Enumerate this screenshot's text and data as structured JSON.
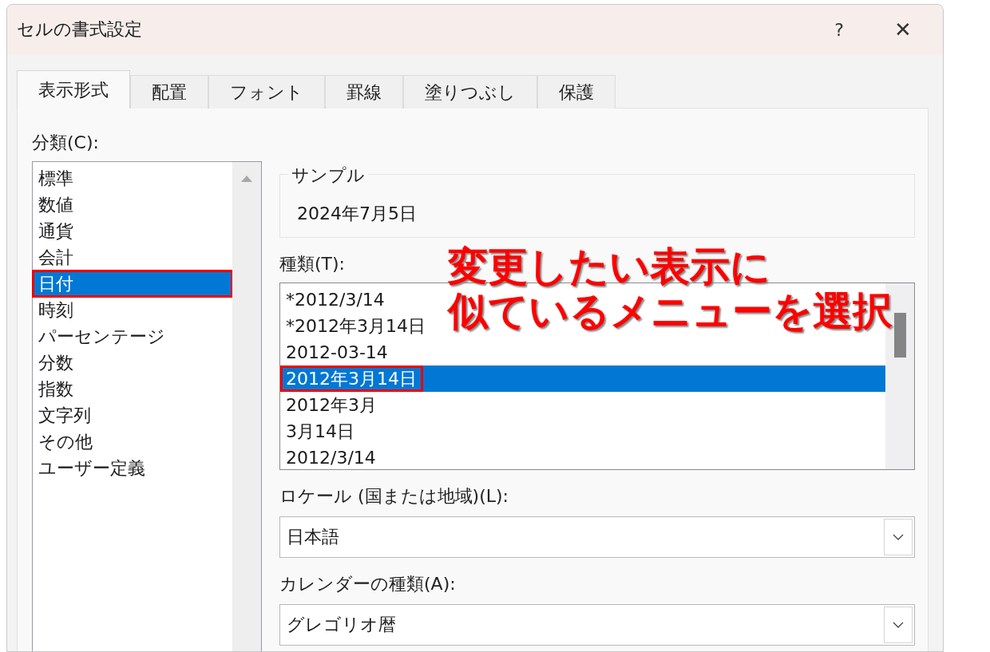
{
  "window": {
    "title": "セルの書式設定",
    "help": "?",
    "close": "✕"
  },
  "tabs": [
    {
      "label": "表示形式",
      "selected": true
    },
    {
      "label": "配置",
      "selected": false
    },
    {
      "label": "フォント",
      "selected": false
    },
    {
      "label": "罫線",
      "selected": false
    },
    {
      "label": "塗りつぶし",
      "selected": false
    },
    {
      "label": "保護",
      "selected": false
    }
  ],
  "category": {
    "label": "分類(C):",
    "items": [
      {
        "label": "標準",
        "selected": false,
        "highlighted": false
      },
      {
        "label": "数値",
        "selected": false,
        "highlighted": false
      },
      {
        "label": "通貨",
        "selected": false,
        "highlighted": false
      },
      {
        "label": "会計",
        "selected": false,
        "highlighted": false
      },
      {
        "label": "日付",
        "selected": true,
        "highlighted": true
      },
      {
        "label": "時刻",
        "selected": false,
        "highlighted": false
      },
      {
        "label": "パーセンテージ",
        "selected": false,
        "highlighted": false
      },
      {
        "label": "分数",
        "selected": false,
        "highlighted": false
      },
      {
        "label": "指数",
        "selected": false,
        "highlighted": false
      },
      {
        "label": "文字列",
        "selected": false,
        "highlighted": false
      },
      {
        "label": "その他",
        "selected": false,
        "highlighted": false
      },
      {
        "label": "ユーザー定義",
        "selected": false,
        "highlighted": false
      }
    ]
  },
  "sample": {
    "label": "サンプル",
    "value": "2024年7月5日"
  },
  "type": {
    "label": "種類(T):",
    "items": [
      {
        "label": "*2012/3/14",
        "selected": false,
        "highlighted": false
      },
      {
        "label": "*2012年3月14日",
        "selected": false,
        "highlighted": false
      },
      {
        "label": "2012-03-14",
        "selected": false,
        "highlighted": false
      },
      {
        "label": "2012年3月14日",
        "selected": true,
        "highlighted": true
      },
      {
        "label": "2012年3月",
        "selected": false,
        "highlighted": false
      },
      {
        "label": "3月14日",
        "selected": false,
        "highlighted": false
      },
      {
        "label": "2012/3/14",
        "selected": false,
        "highlighted": false
      }
    ]
  },
  "locale": {
    "label": "ロケール (国または地域)(L):",
    "value": "日本語"
  },
  "calendar": {
    "label": "カレンダーの種類(A):",
    "value": "グレゴリオ暦"
  },
  "callout": {
    "lines": [
      "変更したい表示に",
      "似ているメニューを選択"
    ]
  }
}
